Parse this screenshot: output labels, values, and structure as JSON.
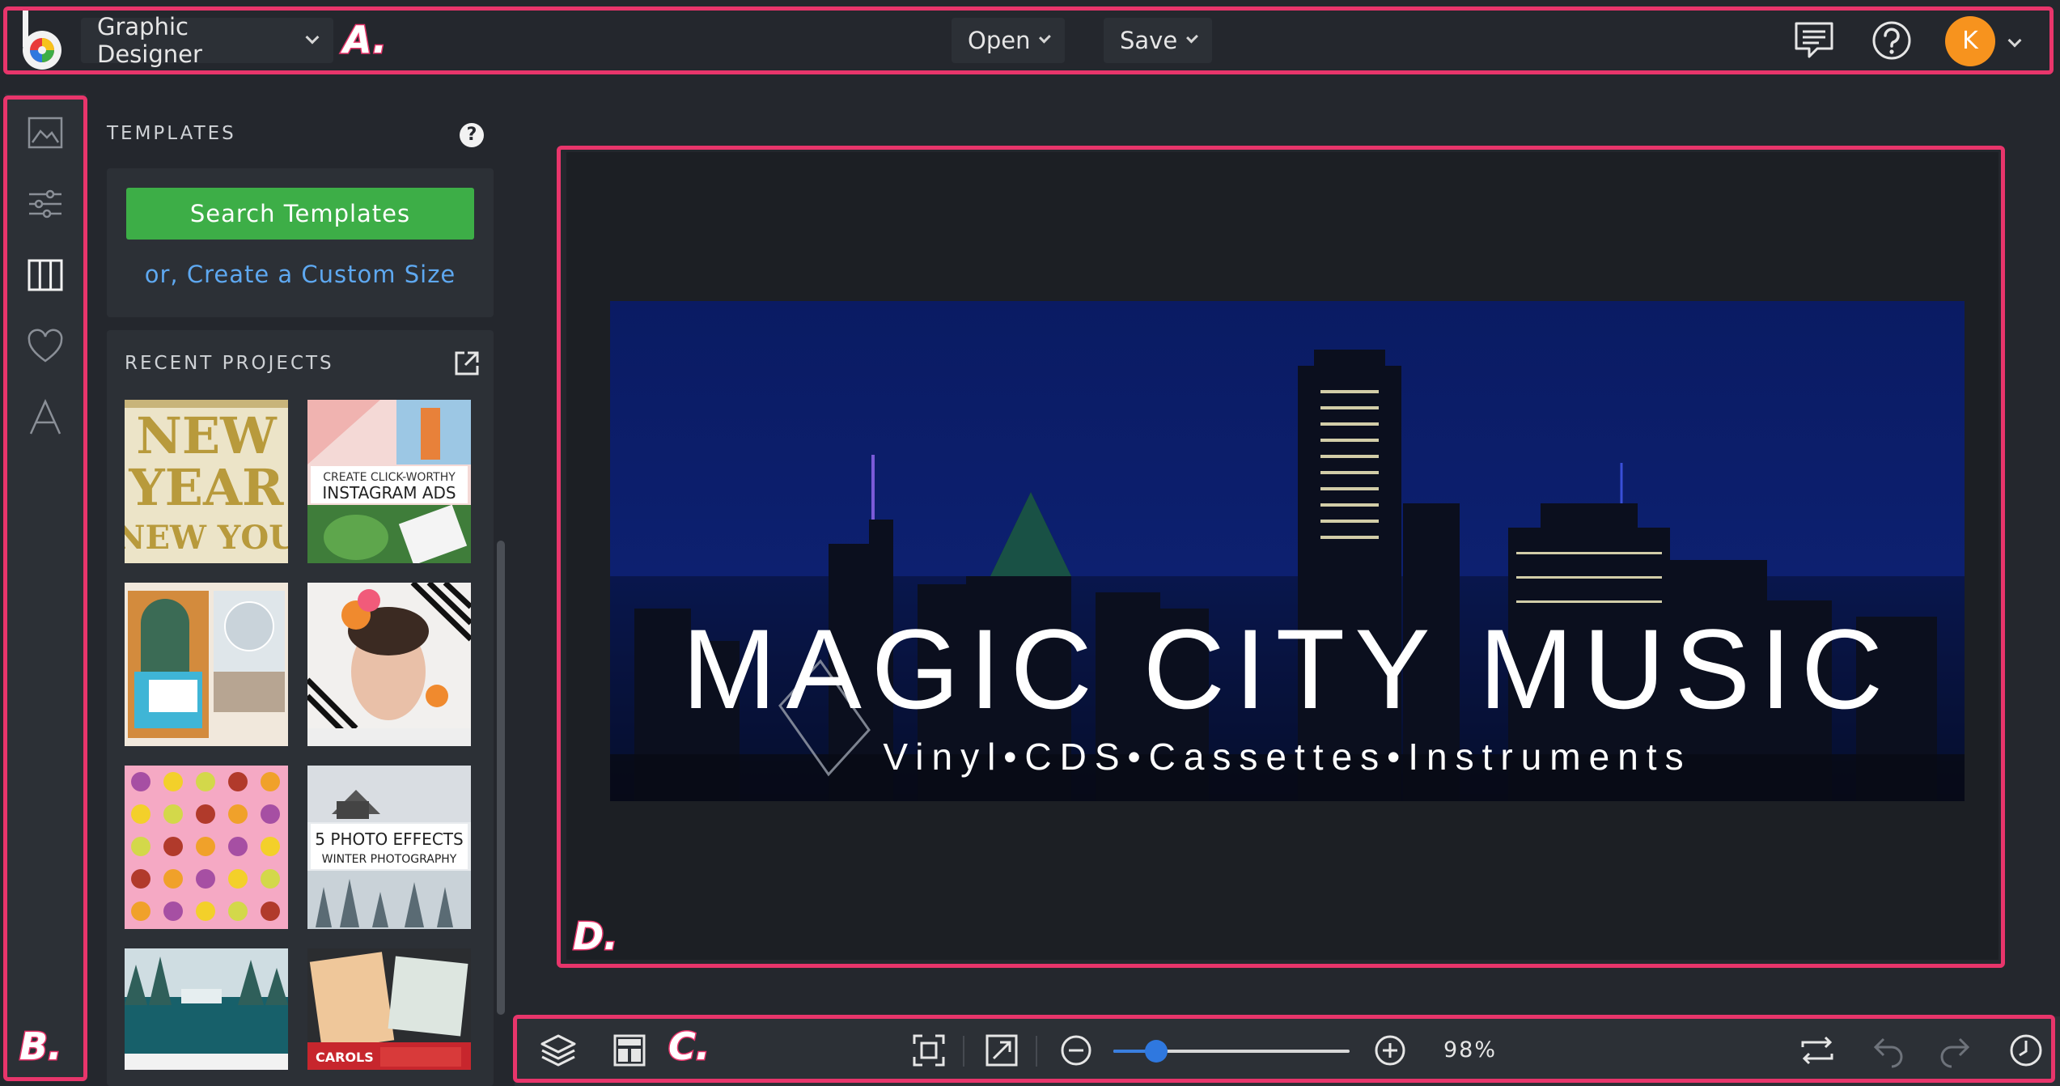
{
  "topbar": {
    "mode_label": "Graphic Designer",
    "open_label": "Open",
    "save_label": "Save",
    "avatar_initial": "K",
    "avatar_color": "#f7931e"
  },
  "markers": {
    "a": "A.",
    "b": "B.",
    "c": "C.",
    "d": "D."
  },
  "panel": {
    "templates_title": "TEMPLATES",
    "help_glyph": "?",
    "search_button": "Search Templates",
    "custom_size_link": "or, Create a Custom Size",
    "recent_title": "RECENT PROJECTS",
    "thumbs": {
      "t1": [
        "NEW",
        "YEAR",
        "NEW YOU"
      ],
      "t2": [
        "CREATE CLICK-WORTHY",
        "INSTAGRAM ADS"
      ],
      "t6": [
        "5 PHOTO EFFECTS",
        "WINTER PHOTOGRAPHY"
      ],
      "t8": "CAROLS"
    }
  },
  "design": {
    "headline": "MAGIC CITY MUSIC",
    "subline": "Vinyl•CDS•Cassettes•Instruments"
  },
  "bottombar": {
    "zoom_value": "98%",
    "zoom_fraction": 0.18
  },
  "colors": {
    "accent": "#e8356b",
    "green": "#3dae47",
    "link": "#5ea8f0",
    "slider": "#2f78df"
  }
}
